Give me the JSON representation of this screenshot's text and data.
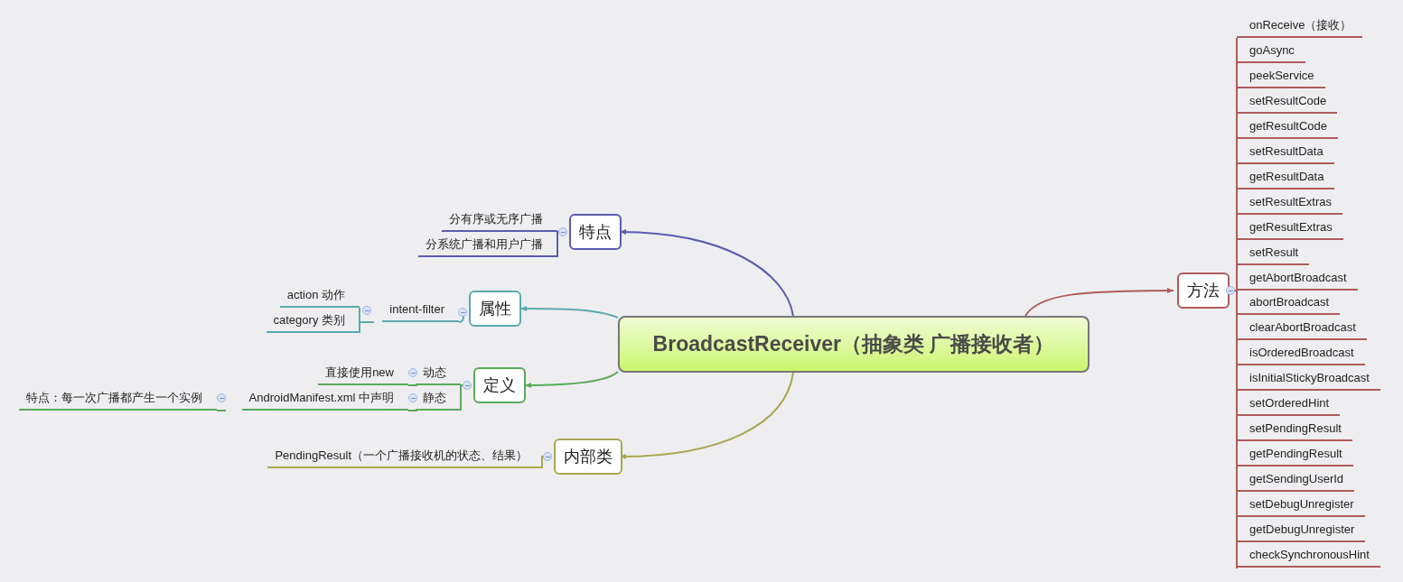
{
  "central_topic": {
    "label": "BroadcastReceiver（抽象类 广播接收者）"
  },
  "branches": [
    {
      "label": "特点",
      "color": "#5b5bb0",
      "children": [
        {
          "label": "分有序或无序广播"
        },
        {
          "label": "分系统广播和用户广播"
        }
      ]
    },
    {
      "label": "属性",
      "color": "#5aabab",
      "children": [
        {
          "label": "intent-filter",
          "children": [
            {
              "label": "action 动作"
            },
            {
              "label": "category 类别"
            }
          ]
        }
      ]
    },
    {
      "label": "定义",
      "color": "#5aaa5a",
      "children": [
        {
          "label": "动态",
          "children": [
            {
              "label": "直接使用new"
            }
          ]
        },
        {
          "label": "静态",
          "children": [
            {
              "label": "AndroidManifest.xml 中声明",
              "children": [
                {
                  "label": "特点：每一次广播都产生一个实例"
                }
              ]
            }
          ]
        }
      ]
    },
    {
      "label": "内部类",
      "color": "#a8a850",
      "children": [
        {
          "label": "PendingResult（一个广播接收机的状态、结果）"
        }
      ]
    },
    {
      "label": "方法",
      "color": "#b05a5a",
      "children": [
        {
          "label": "onReceive（接收）"
        },
        {
          "label": "goAsync"
        },
        {
          "label": "peekService"
        },
        {
          "label": "setResultCode"
        },
        {
          "label": "getResultCode"
        },
        {
          "label": "setResultData"
        },
        {
          "label": "getResultData"
        },
        {
          "label": "setResultExtras"
        },
        {
          "label": "getResultExtras"
        },
        {
          "label": "setResult"
        },
        {
          "label": "getAbortBroadcast"
        },
        {
          "label": "abortBroadcast"
        },
        {
          "label": "clearAbortBroadcast"
        },
        {
          "label": "isOrderedBroadcast"
        },
        {
          "label": "isInitialStickyBroadcast"
        },
        {
          "label": "setOrderedHint"
        },
        {
          "label": "setPendingResult"
        },
        {
          "label": "getPendingResult"
        },
        {
          "label": "getSendingUserId"
        },
        {
          "label": "setDebugUnregister"
        },
        {
          "label": "getDebugUnregister"
        },
        {
          "label": "checkSynchronousHint"
        }
      ]
    }
  ]
}
